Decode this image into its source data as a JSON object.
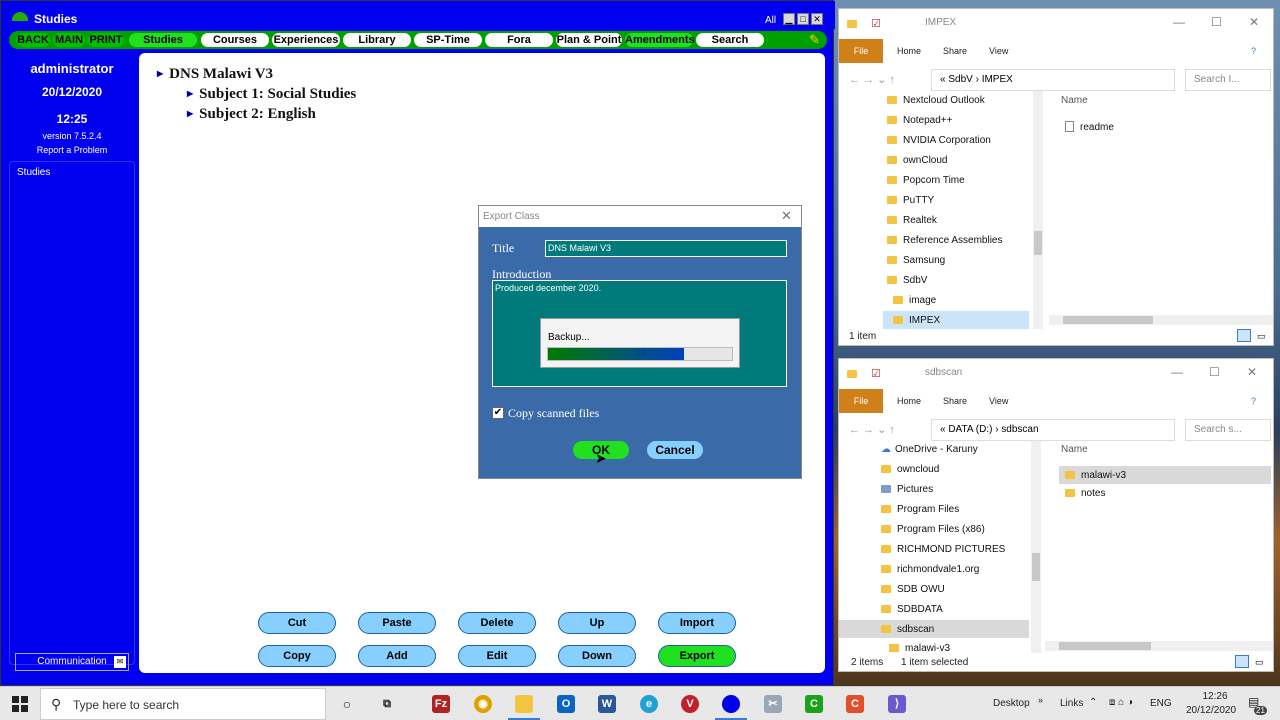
{
  "app": {
    "title": "Studies",
    "all_label": "All",
    "menu": [
      "BACK",
      "MAIN",
      "PRINT",
      "Studies",
      "Courses",
      "Experiences",
      "Library",
      "SP-Time",
      "Fora",
      "Plan & Point",
      "Amendments",
      "Search"
    ],
    "user": "administrator",
    "date": "20/12/2020",
    "time": "12:25",
    "version": "version 7.5.2.4",
    "report": "Report a Problem",
    "sidebar_item": "Studies",
    "communication": "Communication",
    "tree": {
      "root": "DNS Malawi V3",
      "children": [
        "Subject 1: Social Studies",
        "Subject 2: English"
      ]
    },
    "actions_row1": [
      "Cut",
      "Paste",
      "Delete",
      "Up",
      "Import"
    ],
    "actions_row2": [
      "Copy",
      "Add",
      "Edit",
      "Down",
      "Export"
    ]
  },
  "dialog": {
    "title": "Export Class",
    "title_label": "Title",
    "title_value": "DNS Malawi V3",
    "intro_label": "Introduction",
    "intro_value": "Produced december 2020.",
    "backup_label": "Backup...",
    "progress_value": 74,
    "progress_text": "74",
    "copy_label": "Copy scanned files",
    "copy_checked": true,
    "ok": "OK",
    "cancel": "Cancel"
  },
  "explorer1": {
    "title": "IMPEX",
    "tabs": [
      "File",
      "Home",
      "Share",
      "View"
    ],
    "path": "« SdbV › IMPEX",
    "search": "Search I...",
    "tree": [
      "Nextcloud Outlook",
      "Notepad++",
      "NVIDIA Corporation",
      "ownCloud",
      "Popcorn Time",
      "PuTTY",
      "Realtek",
      "Reference Assemblies",
      "Samsung",
      "SdbV",
      "image",
      "IMPEX"
    ],
    "column": "Name",
    "files": [
      "readme"
    ],
    "status": "1 item"
  },
  "explorer2": {
    "title": "sdbscan",
    "tabs": [
      "File",
      "Home",
      "Share",
      "View"
    ],
    "path": "« DATA (D:) › sdbscan",
    "search": "Search s...",
    "tree": [
      "OneDrive - Karuny",
      "owncloud",
      "Pictures",
      "Program Files",
      "Program Files (x86)",
      "RICHMOND PICTURES",
      "richmondvale1.org",
      "SDB OWU",
      "SDBDATA",
      "sdbscan",
      "malawi-v3"
    ],
    "column": "Name",
    "files": [
      "malawi-v3",
      "notes"
    ],
    "status_count": "2 items",
    "status_selected": "1 item selected"
  },
  "taskbar": {
    "search_placeholder": "Type here to search",
    "desktop": "Desktop",
    "links": "Links",
    "lang": "ENG",
    "time": "12:26",
    "date": "20/12/2020",
    "notifications": "21"
  }
}
